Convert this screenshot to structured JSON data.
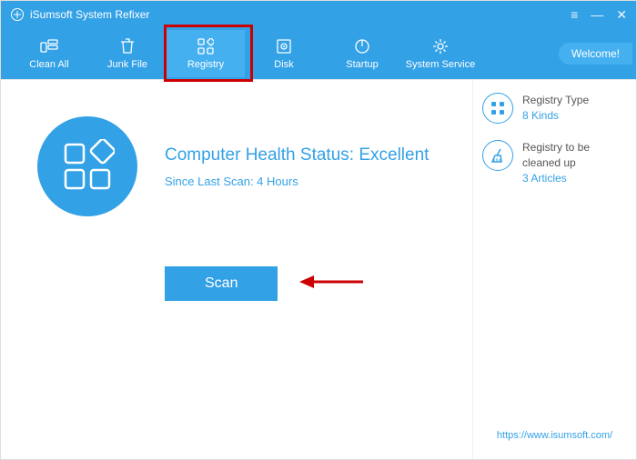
{
  "titlebar": {
    "title": "iSumsoft System Refixer"
  },
  "toolbar": {
    "tabs": [
      {
        "id": "clean-all",
        "label": "Clean All"
      },
      {
        "id": "junk-file",
        "label": "Junk File"
      },
      {
        "id": "registry",
        "label": "Registry",
        "active": true
      },
      {
        "id": "disk",
        "label": "Disk"
      },
      {
        "id": "startup",
        "label": "Startup"
      },
      {
        "id": "system-service",
        "label": "System Service"
      }
    ],
    "welcome_label": "Welcome!"
  },
  "main": {
    "health_status": "Computer Health Status: Excellent",
    "last_scan": "Since Last Scan: 4 Hours",
    "scan_label": "Scan"
  },
  "sidebar": {
    "items": [
      {
        "title": "Registry Type",
        "subtitle": "8 Kinds",
        "icon": "grid"
      },
      {
        "title": "Registry to be cleaned up",
        "subtitle": "3 Articles",
        "icon": "broom"
      }
    ]
  },
  "footer": {
    "url": "https://www.isumsoft.com/"
  }
}
